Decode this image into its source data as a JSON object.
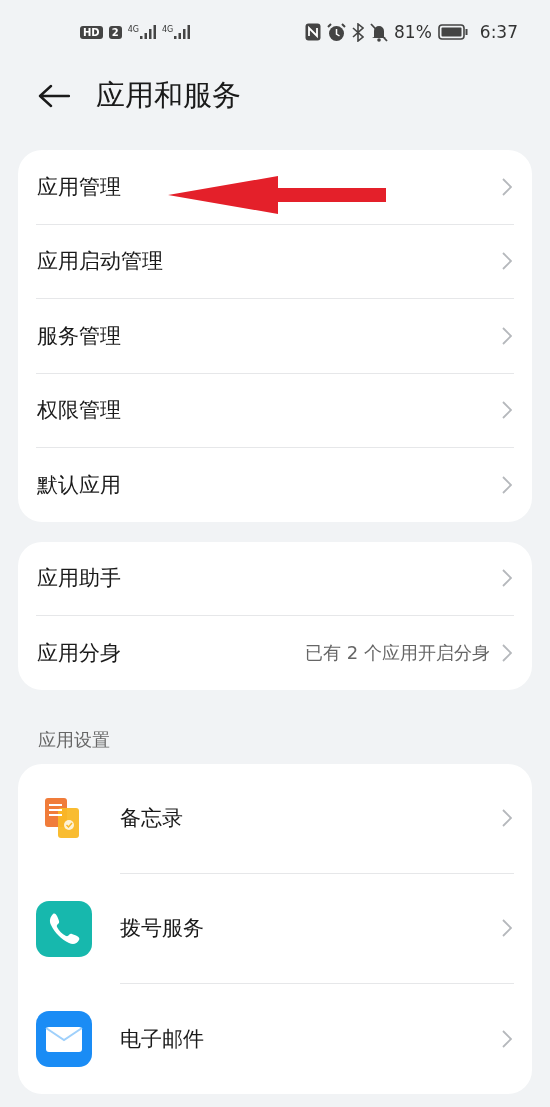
{
  "status_bar": {
    "hd": "HD",
    "sim": "2",
    "networks": [
      "4G",
      "4G"
    ],
    "battery_text": "81%",
    "time": "6:37"
  },
  "header": {
    "title": "应用和服务"
  },
  "groups": [
    {
      "items": [
        {
          "label": "应用管理"
        },
        {
          "label": "应用启动管理"
        },
        {
          "label": "服务管理"
        },
        {
          "label": "权限管理"
        },
        {
          "label": "默认应用"
        }
      ]
    },
    {
      "items": [
        {
          "label": "应用助手"
        },
        {
          "label": "应用分身",
          "value": "已有 2 个应用开启分身"
        }
      ]
    }
  ],
  "section": {
    "title": "应用设置",
    "items": [
      {
        "label": "备忘录",
        "kind": "notes"
      },
      {
        "label": "拨号服务",
        "kind": "phone"
      },
      {
        "label": "电子邮件",
        "kind": "mail"
      }
    ]
  }
}
